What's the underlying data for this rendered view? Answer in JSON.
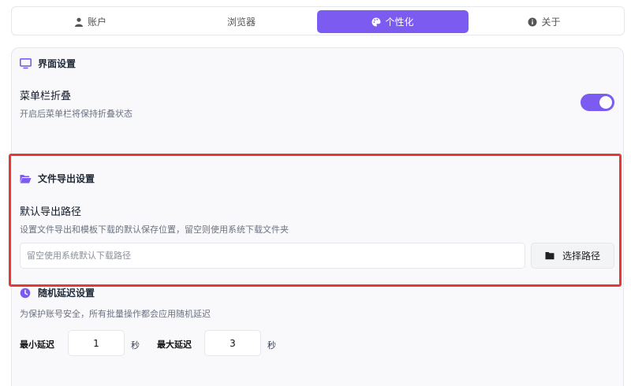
{
  "tabs": [
    {
      "label": "账户",
      "icon": "user-icon"
    },
    {
      "label": "浏览器",
      "icon": ""
    },
    {
      "label": "个性化",
      "icon": "palette-icon",
      "active": true
    },
    {
      "label": "关于",
      "icon": "info-icon"
    }
  ],
  "interface": {
    "title": "界面设置",
    "icon": "monitor-icon",
    "collapse_label": "菜单栏折叠",
    "collapse_desc": "开启后菜单栏将保持折叠状态",
    "collapse_enabled": true
  },
  "export": {
    "title": "文件导出设置",
    "icon": "folder-open-icon",
    "path_label": "默认导出路径",
    "path_desc": "设置文件导出和模板下载的默认保存位置，留空则使用系统下载文件夹",
    "path_value": "",
    "path_placeholder": "留空使用系统默认下载路径",
    "choose_label": "选择路径",
    "choose_icon": "folder-icon"
  },
  "delay": {
    "title": "随机延迟设置",
    "icon": "clock-icon",
    "desc": "为保护账号安全，所有批量操作都会应用随机延迟",
    "min_label": "最小延迟",
    "min_value": "1",
    "min_unit": "秒",
    "max_label": "最大延迟",
    "max_value": "3",
    "max_unit": "秒"
  },
  "colors": {
    "accent": "#7c5cf0",
    "highlight_border": "#e53935"
  }
}
